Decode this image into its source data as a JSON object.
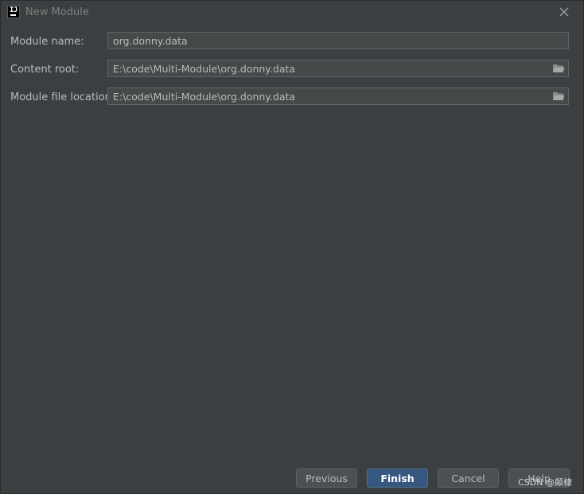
{
  "window": {
    "title": "New Module",
    "app_icon": "intellij-idea-icon",
    "close_icon": "close-icon"
  },
  "form": {
    "module_name": {
      "label": "Module name:",
      "value": "org.donny.data"
    },
    "content_root": {
      "label": "Content root:",
      "value": "E:\\code\\Multi-Module\\org.donny.data",
      "browse_icon": "folder-icon"
    },
    "module_file_location": {
      "label": "Module file location:",
      "value": "E:\\code\\Multi-Module\\org.donny.data",
      "browse_icon": "folder-icon"
    }
  },
  "footer": {
    "previous_label": "Previous",
    "finish_label": "Finish",
    "cancel_label": "Cancel",
    "help_label": "Help"
  },
  "watermark": "CSDN @颠棣",
  "colors": {
    "background": "#3c3f41",
    "field_background": "#45494a",
    "primary_button": "#365880",
    "text": "#bbbbbb"
  }
}
